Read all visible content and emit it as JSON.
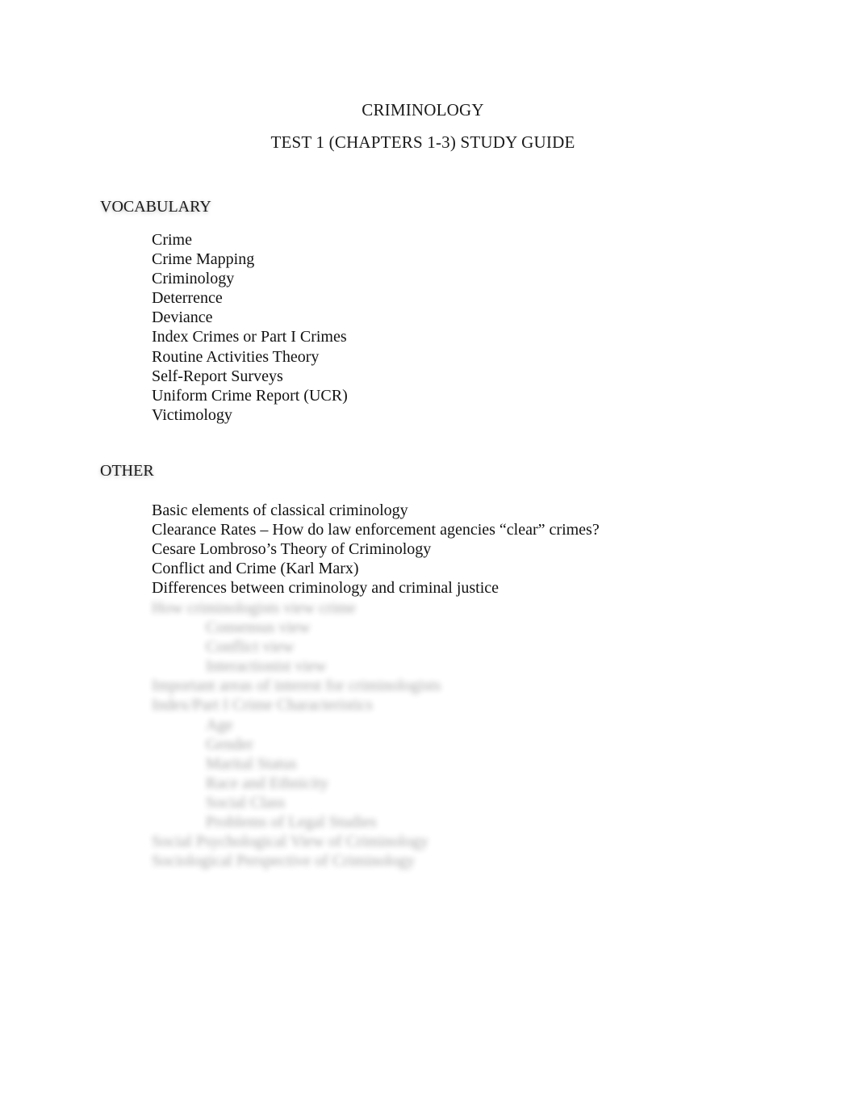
{
  "document": {
    "title": "CRIMINOLOGY",
    "subtitle": "TEST 1 (CHAPTERS 1-3) STUDY GUIDE"
  },
  "sections": [
    {
      "heading": "VOCABULARY",
      "items": [
        "Crime",
        "Crime Mapping",
        "Criminology",
        "Deterrence",
        "Deviance",
        "Index Crimes or Part I Crimes",
        "Routine Activities Theory",
        "Self-Report Surveys",
        "Uniform Crime Report (UCR)",
        "Victimology"
      ]
    },
    {
      "heading": "OTHER",
      "items": [
        "Basic elements of classical criminology",
        "Clearance Rates – How do law enforcement agencies “clear” crimes?",
        "Cesare Lombroso’s Theory of Criminology",
        "Conflict and Crime (Karl Marx)",
        "Differences between criminology and criminal justice"
      ],
      "obscured_items": [
        {
          "indent": 0,
          "text": "How criminologists view crime"
        },
        {
          "indent": 1,
          "text": "Consensus view"
        },
        {
          "indent": 1,
          "text": "Conflict view"
        },
        {
          "indent": 1,
          "text": "Interactionist view"
        },
        {
          "indent": 0,
          "text": "Important areas of interest for criminologists"
        },
        {
          "indent": 0,
          "text": "Index/Part I Crime Characteristics"
        },
        {
          "indent": 1,
          "text": "Age"
        },
        {
          "indent": 1,
          "text": "Gender"
        },
        {
          "indent": 1,
          "text": "Marital Status"
        },
        {
          "indent": 1,
          "text": "Race and Ethnicity"
        },
        {
          "indent": 1,
          "text": "Social Class"
        },
        {
          "indent": 1,
          "text": "Problems of Legal Studies"
        },
        {
          "indent": 0,
          "text": "Social Psychological View of Criminology"
        },
        {
          "indent": 0,
          "text": "Sociological Perspective of Criminology"
        }
      ]
    }
  ]
}
